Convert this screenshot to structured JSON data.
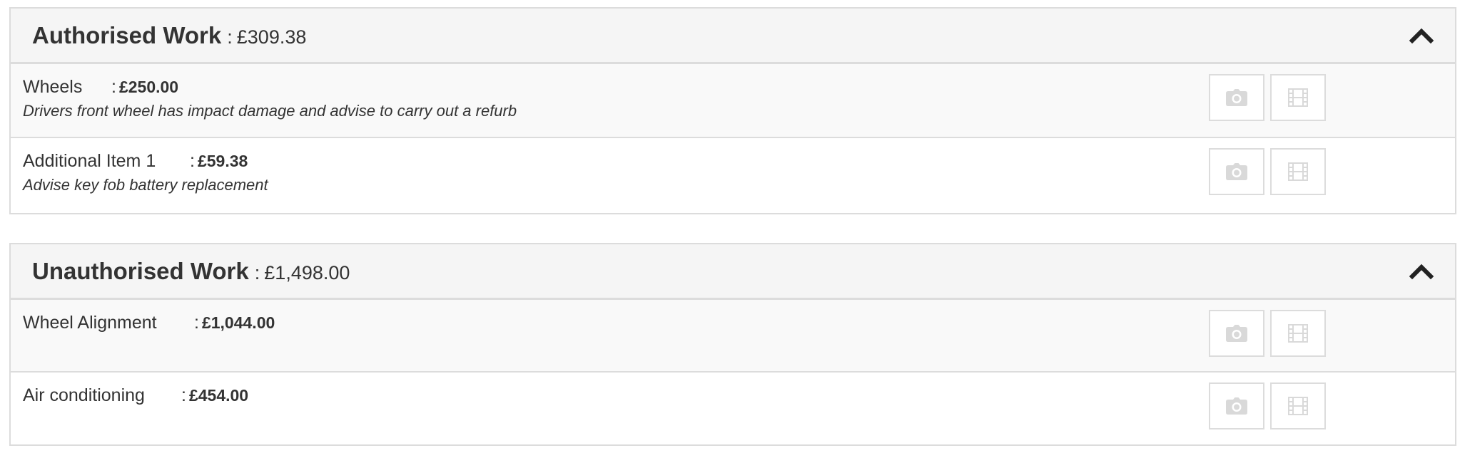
{
  "sections": [
    {
      "title": "Authorised Work",
      "separator": ":",
      "total": "£309.38",
      "collapse_icon": "chevron-up-icon",
      "items": [
        {
          "name": "Wheels",
          "separator": ":",
          "price": "£250.00",
          "description": "Drivers front wheel has impact damage and advise to carry out a refurb",
          "photo_icon": "camera-icon",
          "video_icon": "film-icon"
        },
        {
          "name": "Additional Item 1",
          "separator": ":",
          "price": "£59.38",
          "description": "Advise key fob battery replacement",
          "photo_icon": "camera-icon",
          "video_icon": "film-icon"
        }
      ]
    },
    {
      "title": "Unauthorised Work",
      "separator": ":",
      "total": "£1,498.00",
      "collapse_icon": "chevron-up-icon",
      "items": [
        {
          "name": "Wheel Alignment",
          "separator": ":",
          "price": "£1,044.00",
          "description": "",
          "photo_icon": "camera-icon",
          "video_icon": "film-icon"
        },
        {
          "name": "Air conditioning",
          "separator": ":",
          "price": "£454.00",
          "description": "",
          "photo_icon": "camera-icon",
          "video_icon": "film-icon"
        }
      ]
    }
  ],
  "colors": {
    "heading_background": "#f5f5f5",
    "border": "#dcdcdc",
    "alt_row_background": "#f9f9f9",
    "text": "#333333",
    "icon_disabled": "#d9d9d9"
  }
}
